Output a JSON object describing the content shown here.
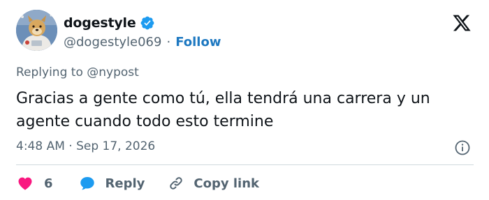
{
  "author": {
    "display_name": "dogestyle",
    "handle": "@dogestyle069",
    "separator": "·",
    "follow_label": "Follow",
    "verified": true
  },
  "reply_context": "Replying to @nypost",
  "tweet": {
    "text": "Gracias a gente como tú, ella tendrá una carrera y un agente cuando todo esto termine",
    "timestamp": "4:48 AM · Sep 17, 2026"
  },
  "actions": {
    "like_count": "6",
    "reply_label": "Reply",
    "copy_link_label": "Copy link"
  },
  "colors": {
    "like": "#f91880",
    "reply": "#1d9bf0",
    "follow": "#1d78c1",
    "verified": "#1d9bf0",
    "muted": "#536471"
  },
  "icons": {
    "brand": "x-logo-icon",
    "verified": "verified-badge-icon",
    "info": "info-icon",
    "like": "heart-icon",
    "reply": "speech-bubble-icon",
    "copy": "link-icon"
  }
}
